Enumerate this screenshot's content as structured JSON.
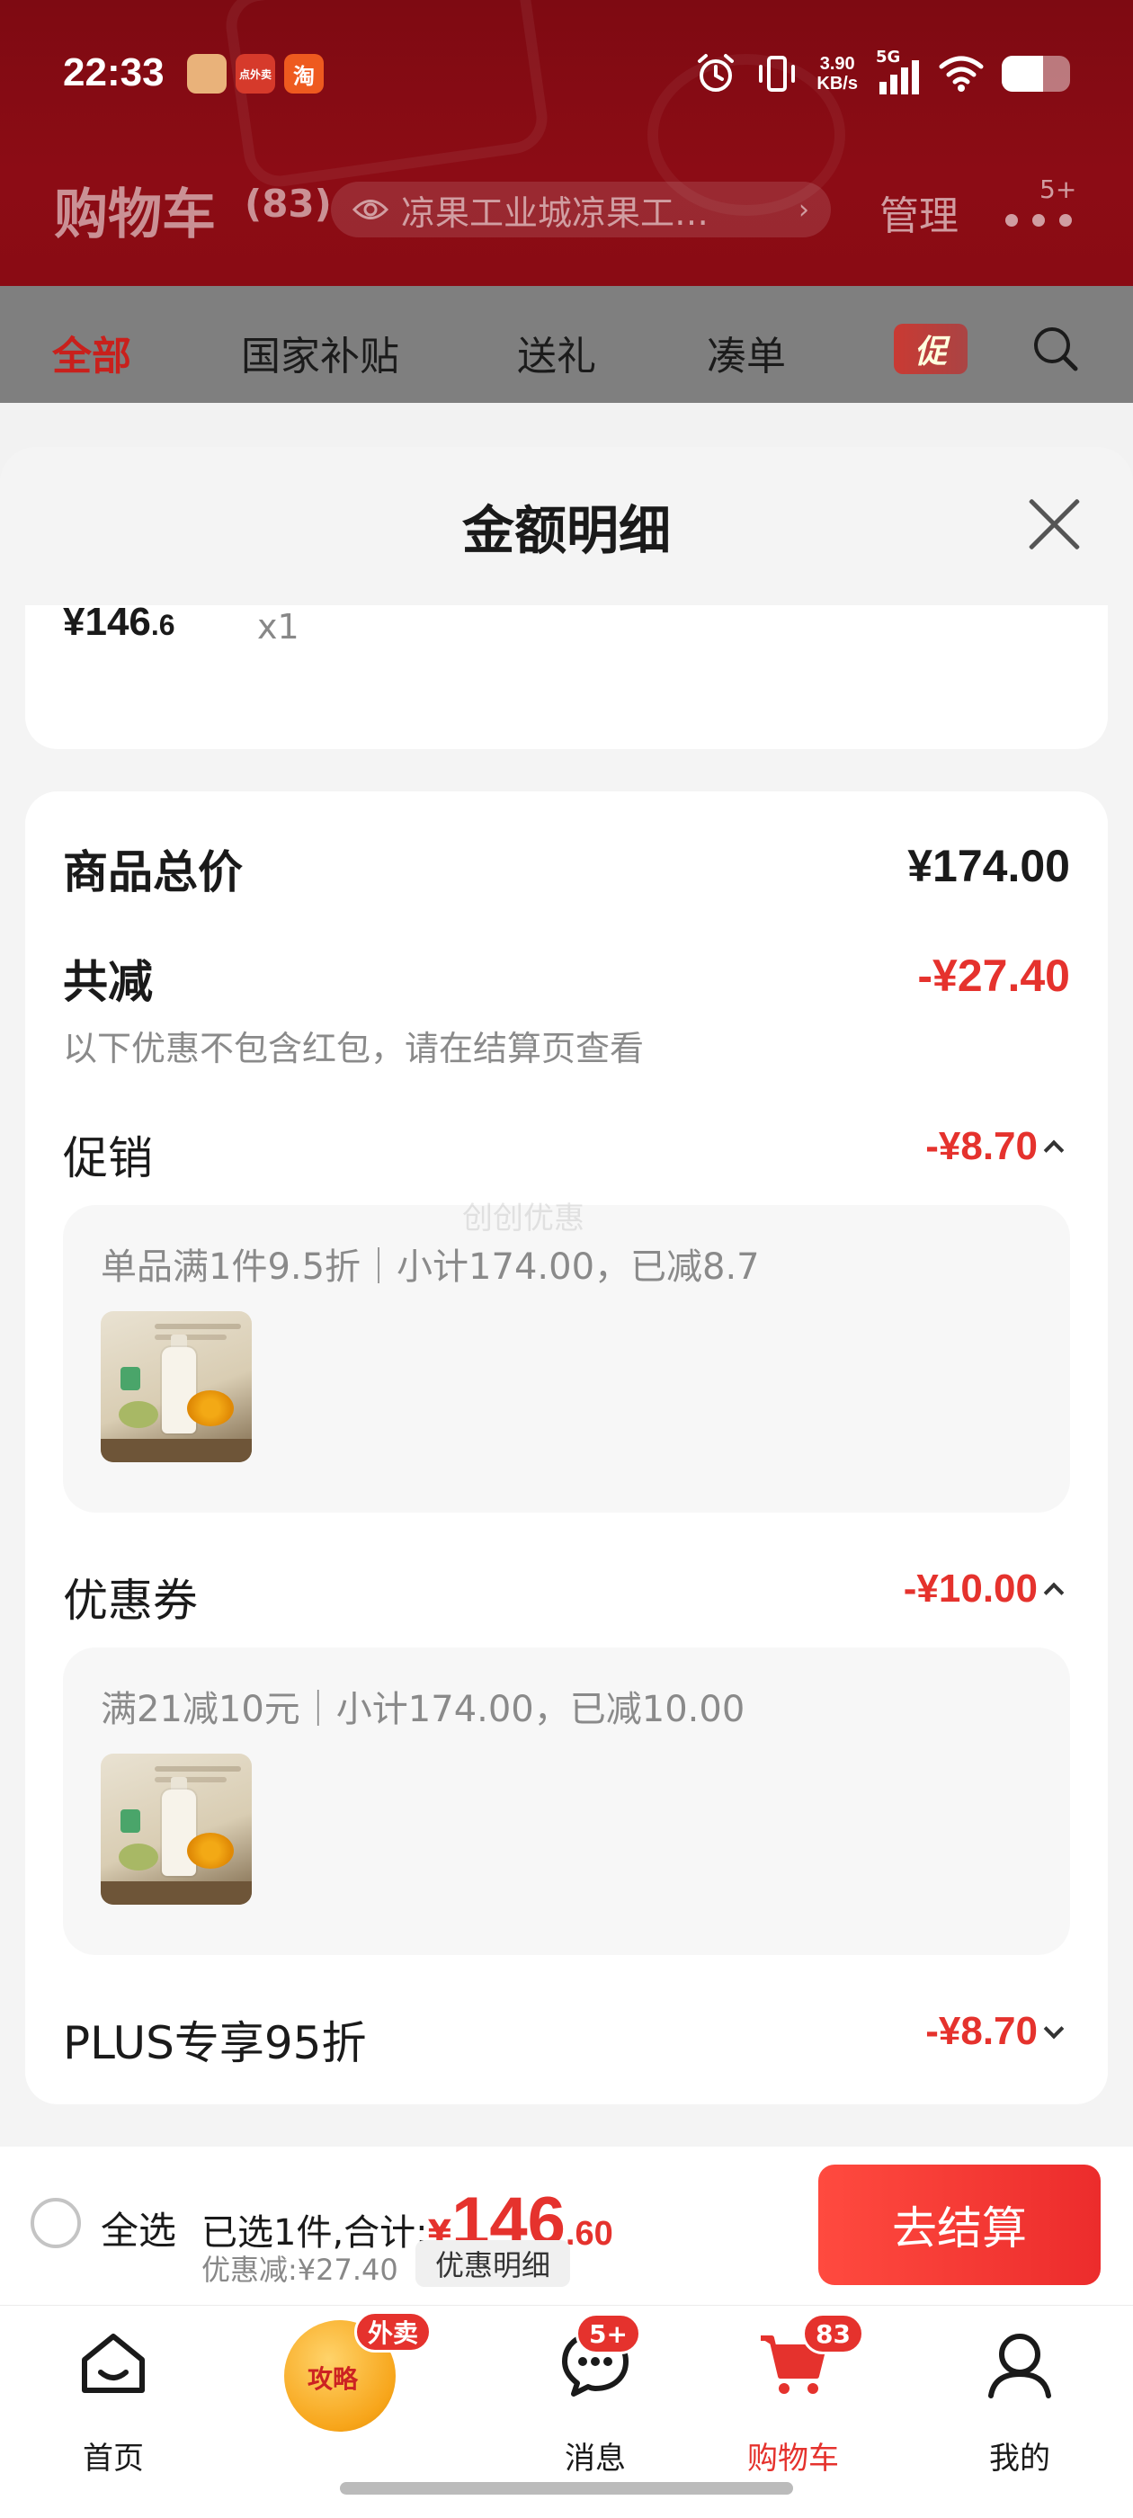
{
  "status_bar": {
    "time": "22:33",
    "net_speed_value": "3.90",
    "net_speed_unit": "KB/s",
    "network": "5G",
    "app_icons": [
      {
        "icon": "calendar-app-icon",
        "label": "",
        "color": "#e9b27a"
      },
      {
        "icon": "waimai-app-icon",
        "label": "点外卖",
        "color": "#d63a2b"
      },
      {
        "icon": "taobao-app-icon",
        "label": "淘",
        "color": "#ee5a1f"
      }
    ],
    "battery_level": 0.6
  },
  "header": {
    "title": "购物车",
    "count": "(83)",
    "address": "凉果工业城凉果工…",
    "manage_label": "管理",
    "more_badge": "5+"
  },
  "tabs": [
    {
      "label": "全部",
      "active": true
    },
    {
      "label": "国家补贴",
      "active": false
    },
    {
      "label": "送礼",
      "active": false
    },
    {
      "label": "凑单",
      "active": false
    }
  ],
  "promo_tab_label": "促",
  "sheet": {
    "title": "金额明细",
    "item": {
      "price_main": "¥146",
      "price_dec": ".6",
      "qty": "x1"
    },
    "total_label": "商品总价",
    "total_value": "¥174.00",
    "reduce_label": "共减",
    "reduce_value": "-¥27.40",
    "reduce_note": "以下优惠不包含红包，请在结算页查看",
    "sections": [
      {
        "label": "促销",
        "value": "-¥8.70",
        "expanded": true,
        "detail": "单品满1件9.5折｜小计174.00，已减8.7"
      },
      {
        "label": "优惠券",
        "value": "-¥10.00",
        "expanded": true,
        "detail": "满21减10元｜小计174.00，已减10.00"
      },
      {
        "label": "PLUS专享95折",
        "value": "-¥8.70",
        "expanded": false,
        "detail": ""
      }
    ],
    "watermark": "创创优惠"
  },
  "checkout": {
    "select_all_label": "全选",
    "selected_prefix": "已选1件,合计:",
    "total_currency": "¥",
    "total_main": "146",
    "total_dec": ".60",
    "discount_text": "优惠减:¥27.40",
    "detail_button": "优惠明细",
    "checkout_button": "去结算"
  },
  "nav": {
    "items": [
      {
        "label": "首页",
        "icon": "home-icon",
        "badge": ""
      },
      {
        "label": "",
        "icon": "strategy-icon",
        "badge": "外卖"
      },
      {
        "label": "消息",
        "icon": "message-icon",
        "badge": "5+"
      },
      {
        "label": "购物车",
        "icon": "cart-icon",
        "badge": "83",
        "active": true
      },
      {
        "label": "我的",
        "icon": "profile-icon",
        "badge": ""
      }
    ],
    "strategy_label": "攻略"
  },
  "colors": {
    "header_red": "#8c0c15",
    "accent_red": "#e5322d",
    "checkout_red": "#ff4a3f"
  }
}
